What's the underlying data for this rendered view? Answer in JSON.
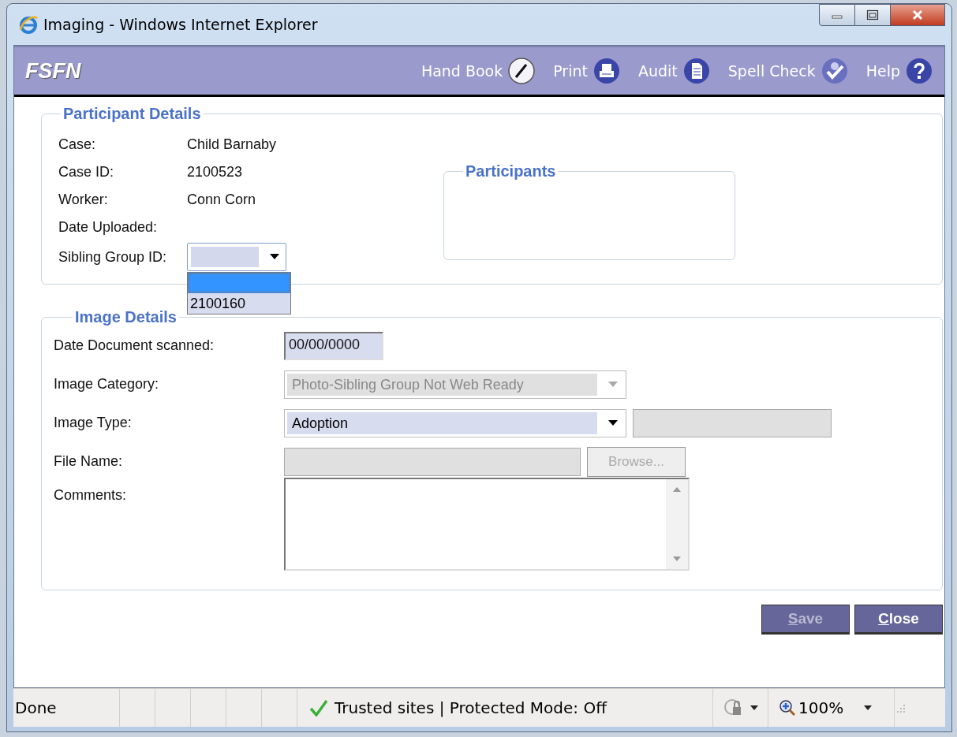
{
  "window": {
    "title": "Imaging - Windows Internet Explorer"
  },
  "header": {
    "logo": "FSFN",
    "tools": [
      {
        "label": "Hand Book",
        "kind": "pencil"
      },
      {
        "label": "Print",
        "kind": "printer"
      },
      {
        "label": "Audit",
        "kind": "document"
      },
      {
        "label": "Spell Check",
        "kind": "spellcheck"
      },
      {
        "label": "Help",
        "kind": "help"
      }
    ]
  },
  "participant_details": {
    "legend": "Participant Details",
    "fields": [
      {
        "label": "Case:",
        "value": "Child Barnaby"
      },
      {
        "label": "Case ID:",
        "value": "2100523"
      },
      {
        "label": "Worker:",
        "value": "Conn Corn"
      },
      {
        "label": "Date Uploaded:"
      }
    ],
    "sibling_group": {
      "label": "Sibling Group ID:",
      "expanded": true,
      "options": [
        {
          "selected": true
        },
        {
          "label": "2100160",
          "selected": false
        }
      ]
    },
    "participants": {
      "legend": "Participants"
    }
  },
  "image_details": {
    "legend": "Image Details",
    "date_scanned": {
      "label": "Date Document scanned:",
      "value": "00/00/0000"
    },
    "image_category": {
      "label": "Image Category:",
      "value": "Photo-Sibling Group Not Web Ready",
      "disabled": true
    },
    "image_type": {
      "label": "Image Type:",
      "value": "Adoption",
      "disabled": false
    },
    "file_name": {
      "label": "File Name:"
    },
    "browse_button": {
      "label": "Browse...",
      "disabled": true
    },
    "comments": {
      "label": "Comments:"
    }
  },
  "buttons": [
    {
      "label": "Save",
      "disabled": true
    },
    {
      "label": "Close",
      "disabled": false
    }
  ],
  "status_bar": {
    "status": "Done",
    "zone": "Trusted sites | Protected Mode: Off",
    "zoom": "100%"
  }
}
